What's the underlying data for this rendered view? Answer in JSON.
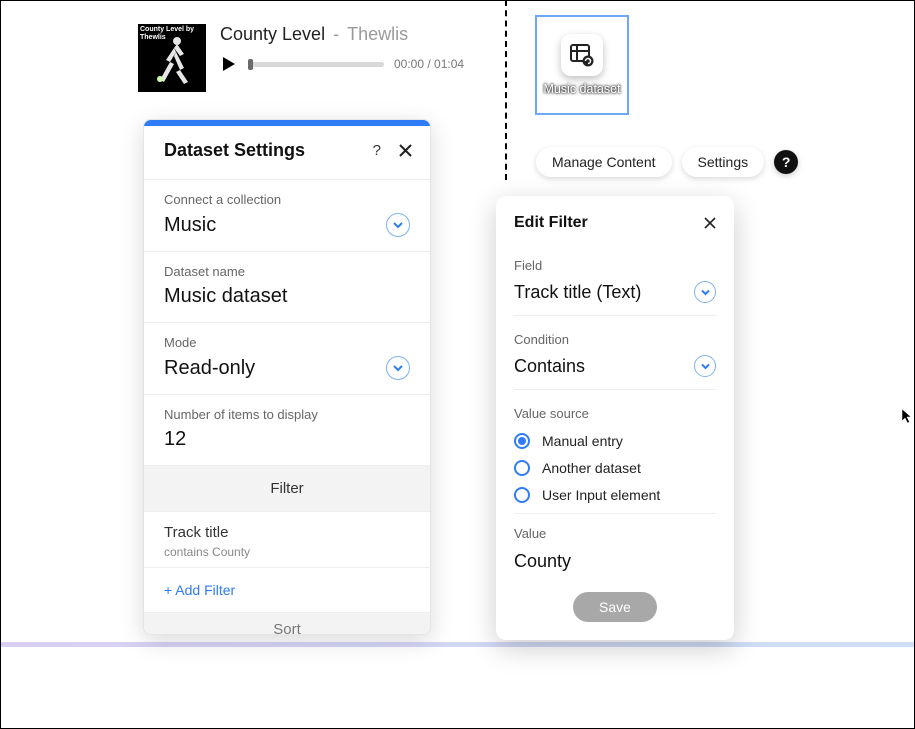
{
  "player": {
    "cover_text": "County Level by Thewlis",
    "title": "County Level",
    "artist": "Thewlis",
    "time_current": "00:00",
    "time_total": "01:04"
  },
  "selected_element": {
    "label": "Music dataset"
  },
  "toolbar": {
    "manage": "Manage Content",
    "settings": "Settings",
    "help": "?"
  },
  "ds_panel": {
    "title": "Dataset Settings",
    "help": "?",
    "collection_label": "Connect a collection",
    "collection_value": "Music",
    "name_label": "Dataset name",
    "name_value": "Music dataset",
    "mode_label": "Mode",
    "mode_value": "Read-only",
    "count_label": "Number of items to display",
    "count_value": "12",
    "filter_header": "Filter",
    "filter_item_title": "Track title",
    "filter_item_desc": "contains County",
    "add_filter": "+ Add Filter",
    "sort_header": "Sort"
  },
  "ef_panel": {
    "title": "Edit Filter",
    "field_label": "Field",
    "field_value": "Track title (Text)",
    "condition_label": "Condition",
    "condition_value": "Contains",
    "source_label": "Value source",
    "source_options": [
      "Manual entry",
      "Another dataset",
      "User Input element"
    ],
    "source_selected_index": 0,
    "value_label": "Value",
    "value_value": "County",
    "save": "Save"
  }
}
